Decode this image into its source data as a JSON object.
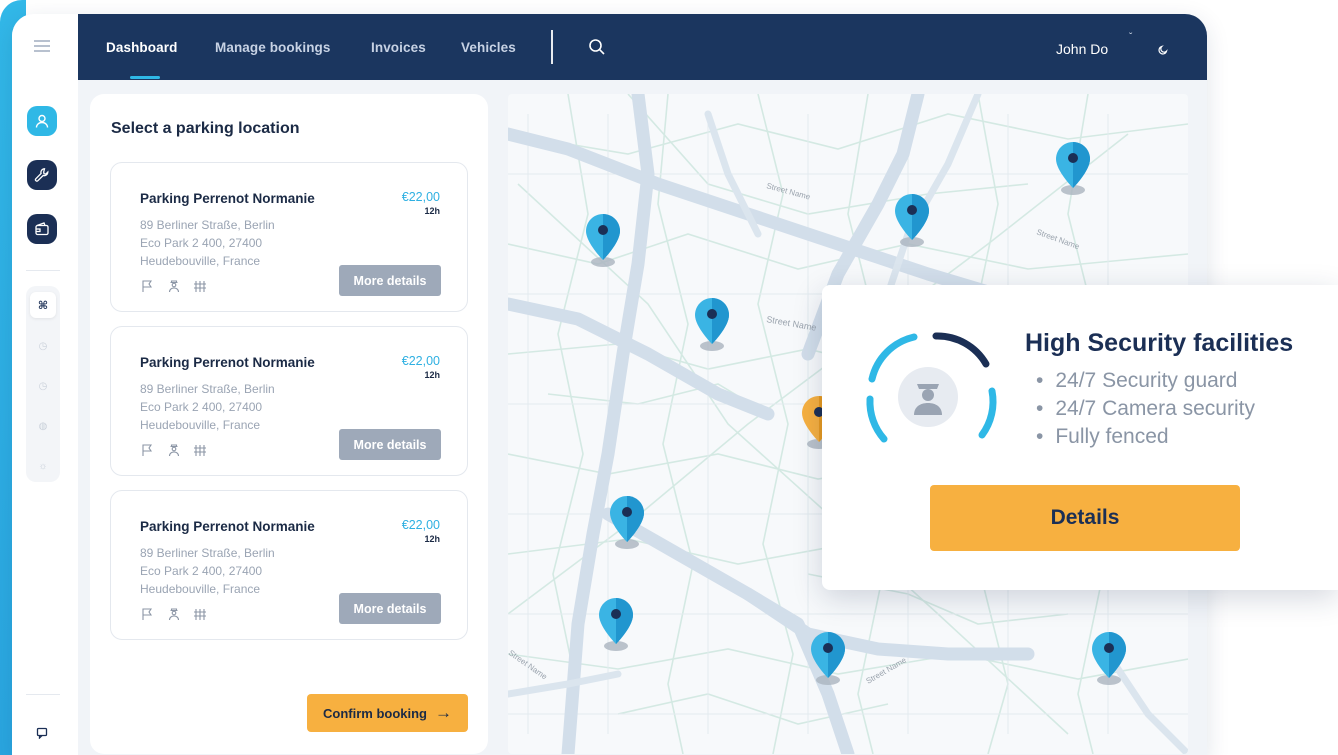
{
  "nav": {
    "items": [
      {
        "label": "Dashboard",
        "active": true
      },
      {
        "label": "Manage bookings",
        "active": false
      },
      {
        "label": "Invoices",
        "active": false
      },
      {
        "label": "Vehicles",
        "active": false
      }
    ],
    "user_name": "John Do",
    "search_icon": "search-icon",
    "theme_icon": "moon-icon"
  },
  "sidebar": {
    "icons": [
      "menu-icon",
      "user-icon",
      "wrench-icon",
      "wallet-icon",
      "command-icon",
      "clock-icon",
      "clock-icon",
      "globe-icon",
      "sun-icon",
      "chat-icon"
    ]
  },
  "panel": {
    "title": "Select a parking location",
    "cards": [
      {
        "name": "Parking Perrenot Normanie",
        "address": [
          "89 Berliner Straße, Berlin",
          "Eco Park 2 400, 27400",
          "Heudebouville, France"
        ],
        "price": "€22,00",
        "unit": "12h",
        "button": "More details"
      },
      {
        "name": "Parking Perrenot Normanie",
        "address": [
          "89 Berliner Straße, Berlin",
          "Eco Park 2 400, 27400",
          "Heudebouville, France"
        ],
        "price": "€22,00",
        "unit": "12h",
        "button": "More details"
      },
      {
        "name": "Parking Perrenot Normanie",
        "address": [
          "89 Berliner Straße, Berlin",
          "Eco Park 2 400, 27400",
          "Heudebouville, France"
        ],
        "price": "€22,00",
        "unit": "12h",
        "button": "More details"
      }
    ],
    "confirm_label": "Confirm booking",
    "confirm_arrow": "→"
  },
  "map": {
    "street_labels": [
      "Street Name",
      "Street Name",
      "Street Name",
      "Street Name",
      "Street Name"
    ]
  },
  "popup": {
    "title": "High Security facilities",
    "features": [
      "24/7 Security guard",
      "24/7 Camera security",
      "Fully fenced"
    ],
    "button": "Details"
  },
  "colors": {
    "navy": "#1b365f",
    "accent_blue": "#2fb8e6",
    "orange": "#f7b040",
    "grey_button": "#9ea9b9"
  }
}
